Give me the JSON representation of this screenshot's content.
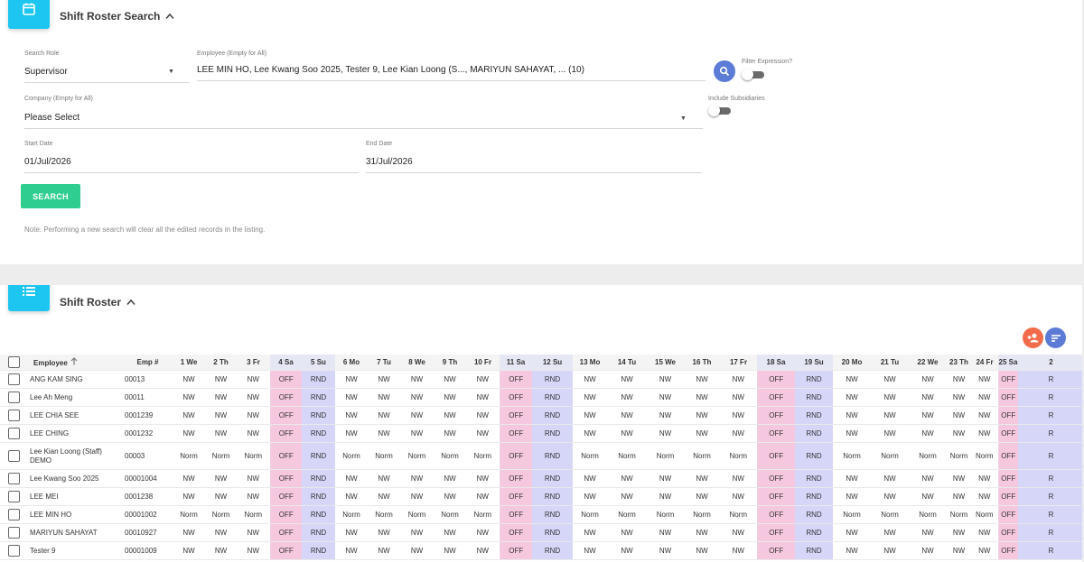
{
  "search_panel": {
    "title": "Shift Roster Search",
    "search_role_label": "Search Role",
    "search_role_value": "Supervisor",
    "employee_label": "Employee (Empty for All)",
    "employee_value": "LEE MIN HO, Lee Kwang Soo 2025, Tester 9, Lee Kian Loong (S..., MARIYUN SAHAYAT, ... (10)",
    "filter_expression_label": "Filter Expression?",
    "company_label": "Company (Empty for All)",
    "company_value": "Please Select",
    "include_subsidiaries_label": "Include Subsidiaries",
    "start_date_label": "Start Date",
    "start_date_value": "01/Jul/2026",
    "end_date_label": "End Date",
    "end_date_value": "31/Jul/2026",
    "search_button": "SEARCH",
    "note": "Note: Performing a new search will clear all the edited records in the listing."
  },
  "roster": {
    "title": "Shift Roster",
    "col_employee": "Employee",
    "col_emp_no": "Emp #",
    "days": [
      "1 We",
      "2 Th",
      "3 Fr",
      "4 Sa",
      "5 Su",
      "6 Mo",
      "7 Tu",
      "8 We",
      "9 Th",
      "10 Fr",
      "11 Sa",
      "12 Su",
      "13 Mo",
      "14 Tu",
      "15 We",
      "16 Th",
      "17 Fr",
      "18 Sa",
      "19 Su",
      "20 Mo",
      "21 Tu",
      "22 We",
      "23 Th",
      "24 Fr",
      "25 Sa",
      "2"
    ],
    "rows": [
      {
        "name": "ANG KAM SING",
        "emp_no": "00013",
        "cells": [
          "NW",
          "NW",
          "NW",
          "OFF",
          "RND",
          "NW",
          "NW",
          "NW",
          "NW",
          "NW",
          "OFF",
          "RND",
          "NW",
          "NW",
          "NW",
          "NW",
          "NW",
          "OFF",
          "RND",
          "NW",
          "NW",
          "NW",
          "NW",
          "NW",
          "OFF",
          "R"
        ]
      },
      {
        "name": "Lee Ah Meng",
        "emp_no": "00011",
        "cells": [
          "NW",
          "NW",
          "NW",
          "OFF",
          "RND",
          "NW",
          "NW",
          "NW",
          "NW",
          "NW",
          "OFF",
          "RND",
          "NW",
          "NW",
          "NW",
          "NW",
          "NW",
          "OFF",
          "RND",
          "NW",
          "NW",
          "NW",
          "NW",
          "NW",
          "OFF",
          "R"
        ]
      },
      {
        "name": "LEE CHIA SEE",
        "emp_no": "0001239",
        "cells": [
          "NW",
          "NW",
          "NW",
          "OFF",
          "RND",
          "NW",
          "NW",
          "NW",
          "NW",
          "NW",
          "OFF",
          "RND",
          "NW",
          "NW",
          "NW",
          "NW",
          "NW",
          "OFF",
          "RND",
          "NW",
          "NW",
          "NW",
          "NW",
          "NW",
          "OFF",
          "R"
        ]
      },
      {
        "name": "LEE CHING",
        "emp_no": "0001232",
        "cells": [
          "NW",
          "NW",
          "NW",
          "OFF",
          "RND",
          "NW",
          "NW",
          "NW",
          "NW",
          "NW",
          "OFF",
          "RND",
          "NW",
          "NW",
          "NW",
          "NW",
          "NW",
          "OFF",
          "RND",
          "NW",
          "NW",
          "NW",
          "NW",
          "NW",
          "OFF",
          "R"
        ]
      },
      {
        "name": "Lee Kian Loong (Staff) DEMO",
        "emp_no": "00003",
        "cells": [
          "Norm",
          "Norm",
          "Norm",
          "OFF",
          "RND",
          "Norm",
          "Norm",
          "Norm",
          "Norm",
          "Norm",
          "OFF",
          "RND",
          "Norm",
          "Norm",
          "Norm",
          "Norm",
          "Norm",
          "OFF",
          "RND",
          "Norm",
          "Norm",
          "Norm",
          "Norm",
          "Norm",
          "OFF",
          "R"
        ]
      },
      {
        "name": "Lee Kwang Soo 2025",
        "emp_no": "00001004",
        "cells": [
          "NW",
          "NW",
          "NW",
          "OFF",
          "RND",
          "NW",
          "NW",
          "NW",
          "NW",
          "NW",
          "OFF",
          "RND",
          "NW",
          "NW",
          "NW",
          "NW",
          "NW",
          "OFF",
          "RND",
          "NW",
          "NW",
          "NW",
          "NW",
          "NW",
          "OFF",
          "R"
        ]
      },
      {
        "name": "LEE MEI",
        "emp_no": "0001238",
        "cells": [
          "NW",
          "NW",
          "NW",
          "OFF",
          "RND",
          "NW",
          "NW",
          "NW",
          "NW",
          "NW",
          "OFF",
          "RND",
          "NW",
          "NW",
          "NW",
          "NW",
          "NW",
          "OFF",
          "RND",
          "NW",
          "NW",
          "NW",
          "NW",
          "NW",
          "OFF",
          "R"
        ]
      },
      {
        "name": "LEE MIN HO",
        "emp_no": "00001002",
        "cells": [
          "Norm",
          "Norm",
          "Norm",
          "OFF",
          "RND",
          "Norm",
          "Norm",
          "Norm",
          "Norm",
          "Norm",
          "OFF",
          "RND",
          "Norm",
          "Norm",
          "Norm",
          "Norm",
          "Norm",
          "OFF",
          "RND",
          "Norm",
          "Norm",
          "Norm",
          "Norm",
          "Norm",
          "OFF",
          "R"
        ]
      },
      {
        "name": "MARIYUN SAHAYAT",
        "emp_no": "00010927",
        "cells": [
          "NW",
          "NW",
          "NW",
          "OFF",
          "RND",
          "NW",
          "NW",
          "NW",
          "NW",
          "NW",
          "OFF",
          "RND",
          "NW",
          "NW",
          "NW",
          "NW",
          "NW",
          "OFF",
          "RND",
          "NW",
          "NW",
          "NW",
          "NW",
          "NW",
          "OFF",
          "R"
        ]
      },
      {
        "name": "Tester 9",
        "emp_no": "00001009",
        "cells": [
          "NW",
          "NW",
          "NW",
          "OFF",
          "RND",
          "NW",
          "NW",
          "NW",
          "NW",
          "NW",
          "OFF",
          "RND",
          "NW",
          "NW",
          "NW",
          "NW",
          "NW",
          "OFF",
          "RND",
          "NW",
          "NW",
          "NW",
          "NW",
          "NW",
          "OFF",
          "R"
        ]
      }
    ]
  },
  "icons": {
    "search_card": "calendar-icon",
    "roster_card": "list-icon",
    "search_round": "search-icon",
    "add_person": "add-person-icon",
    "sort": "sort-icon",
    "collapse": "chevron-up-icon",
    "sort_column": "arrow-up-icon"
  },
  "colors": {
    "accent": "#1cc6f0",
    "search_button": "#2fce8e",
    "search_round": "#5b7bd6",
    "add_person": "#f26b4a",
    "sort": "#5b7bd6",
    "off_cell": "#f6c8df",
    "rnd_cell": "#d5d6f8"
  }
}
